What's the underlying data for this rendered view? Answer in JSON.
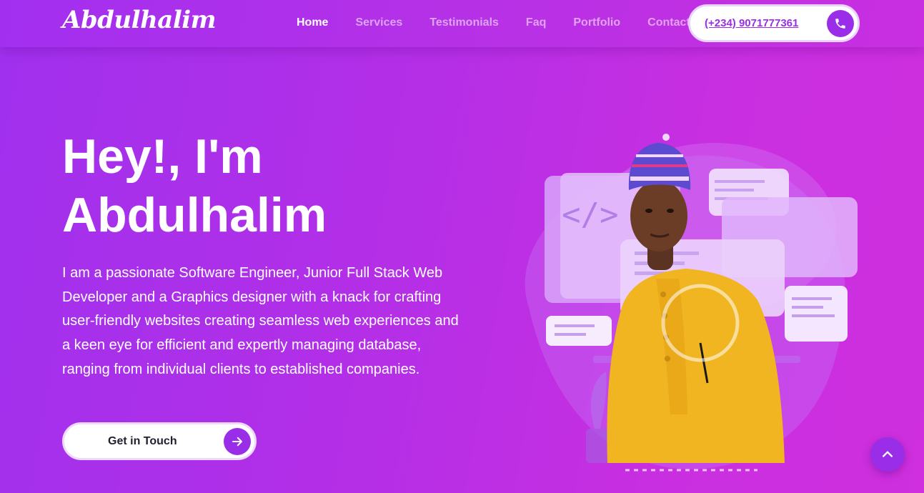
{
  "brand": {
    "logo_text": "Abdulhalim"
  },
  "nav": {
    "items": [
      {
        "label": "Home",
        "active": true
      },
      {
        "label": "Services",
        "active": false
      },
      {
        "label": "Testimonials",
        "active": false
      },
      {
        "label": "Faq",
        "active": false
      },
      {
        "label": "Portfolio",
        "active": false
      },
      {
        "label": "Contact",
        "active": false
      }
    ],
    "phone": "(+234) 9071777361",
    "phone_icon": "phone-icon"
  },
  "hero": {
    "title_line1": "Hey!, I'm",
    "title_line2": "Abdulhalim",
    "description": "I am a passionate Software Engineer, Junior Full Stack Web Developer and a Graphics designer with a knack for crafting user-friendly websites creating seamless web experiences and a keen eye for efficient and expertly managing database, ranging from individual clients to established companies.",
    "cta_label": "Get in Touch",
    "cta_icon": "arrow-right-icon",
    "code_glyph": "</>"
  },
  "scroll_top_icon": "chevron-up-icon",
  "colors": {
    "accent": "#9a2ee8",
    "gradient_start": "#a030ee",
    "gradient_end": "#cf2fde",
    "shirt": "#f0b520"
  }
}
